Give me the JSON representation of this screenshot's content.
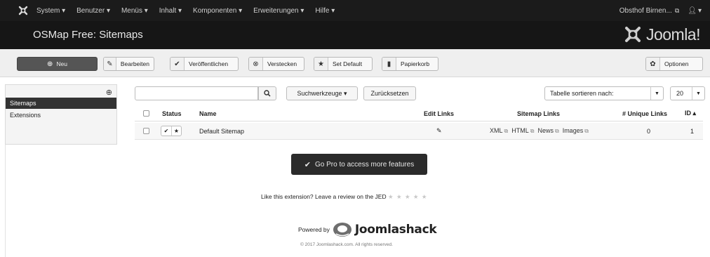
{
  "topnav": {
    "menu": [
      "System ▾",
      "Benutzer ▾",
      "Menüs ▾",
      "Inhalt ▾",
      "Komponenten ▾",
      "Erweiterungen ▾",
      "Hilfe ▾"
    ],
    "site_link": "Obsthof Birnen...",
    "user_menu": "▾"
  },
  "header": {
    "title": "OSMap Free: Sitemaps",
    "brand": "Joomla!"
  },
  "toolbar": {
    "new_label": "Neu",
    "edit_label": "Bearbeiten",
    "publish_label": "Veröffentlichen",
    "hide_label": "Verstecken",
    "default_label": "Set Default",
    "trash_label": "Papierkorb",
    "options_label": "Optionen"
  },
  "sidebar": {
    "items": [
      {
        "label": "Sitemaps",
        "active": true
      },
      {
        "label": "Extensions",
        "active": false
      }
    ]
  },
  "filters": {
    "search_value": "",
    "search_tools_label": "Suchwerkzeuge ▾",
    "reset_label": "Zurücksetzen",
    "sort_label": "Tabelle sortieren nach:",
    "limit_value": "20"
  },
  "table": {
    "headers": {
      "status": "Status",
      "name": "Name",
      "edit_links": "Edit Links",
      "sitemap_links": "Sitemap Links",
      "unique_links": "# Unique Links",
      "id": "ID ▴"
    },
    "rows": [
      {
        "name": "Default Sitemap",
        "links": [
          "XML",
          "HTML",
          "News",
          "Images"
        ],
        "unique_links": "0",
        "id": "1"
      }
    ]
  },
  "promo": {
    "gopro_label": "Go Pro to access more features",
    "review_text": "Like this extension? Leave a review on the JED",
    "stars": "★ ★ ★ ★ ★",
    "powered_by": "Powered by",
    "vendor": "Joomlashack",
    "copyright": "© 2017 Joomlashack.com. All rights reserved."
  },
  "colors": {
    "topnav_bg": "#1b1b1b",
    "header_bg": "#161616",
    "new_button": "#555555",
    "gopro_bg": "#2b2b2b"
  }
}
